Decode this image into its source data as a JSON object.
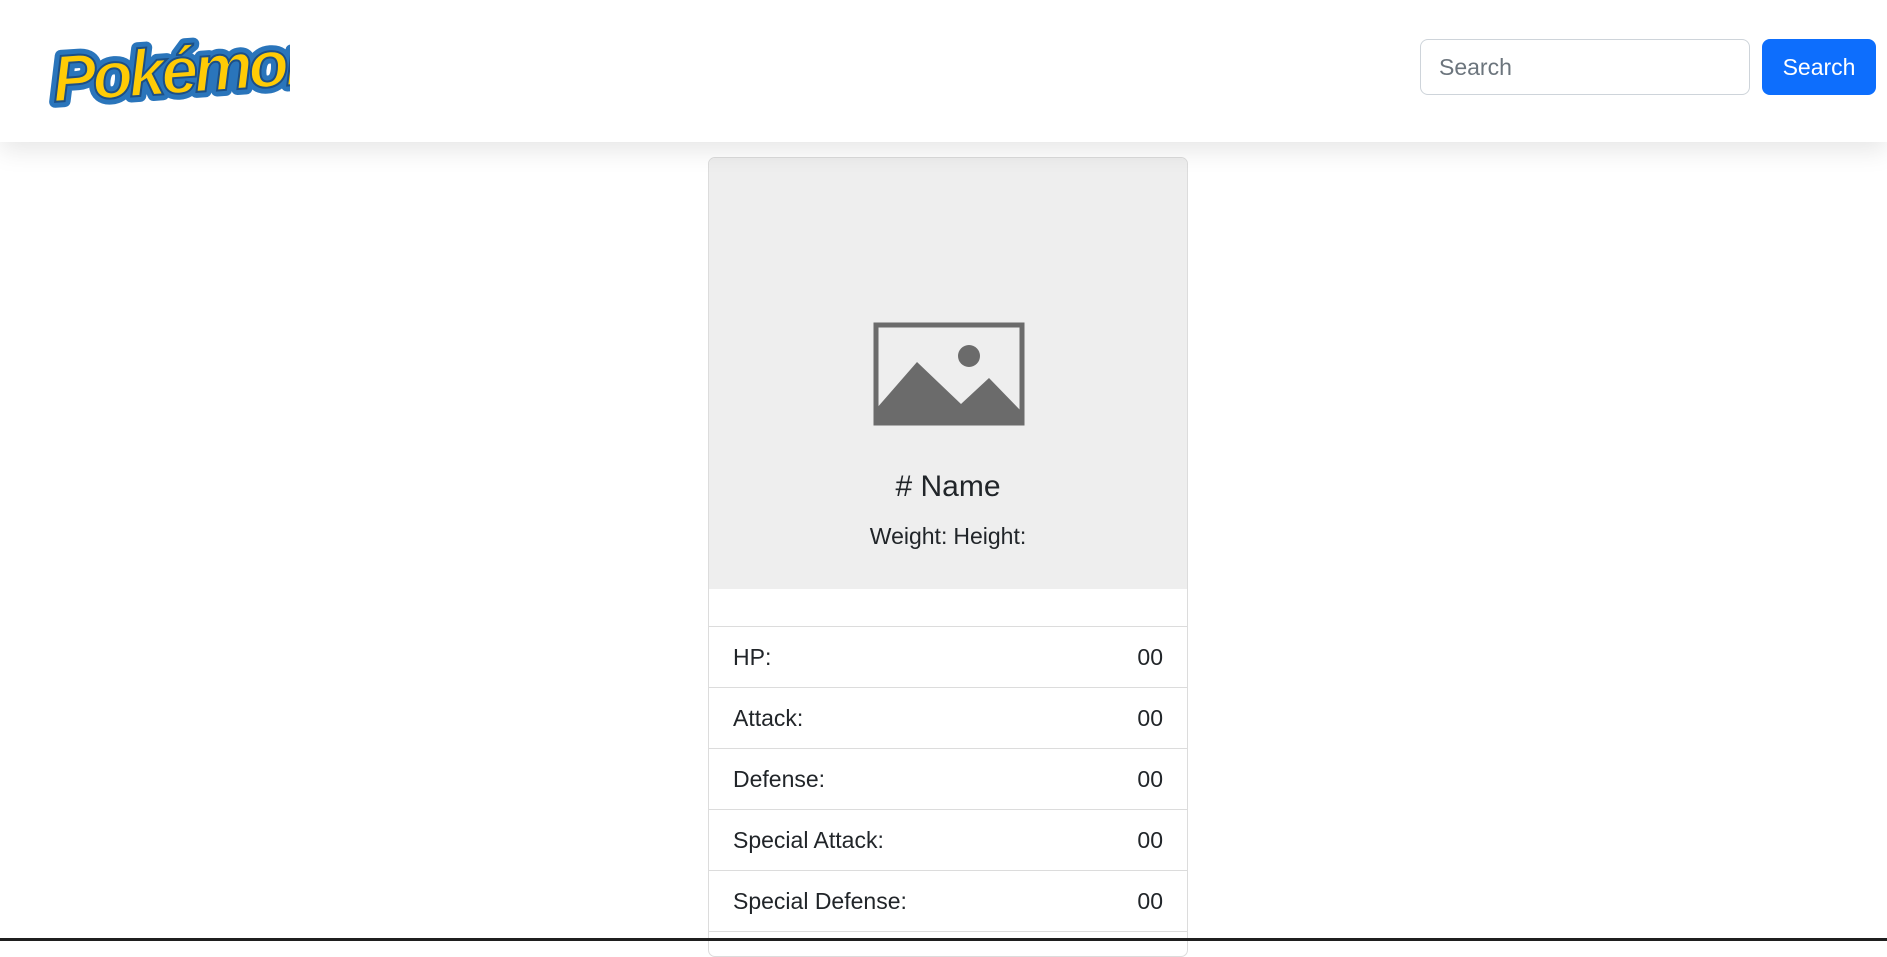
{
  "header": {
    "logo_text": "Pokémon",
    "search": {
      "placeholder": "Search",
      "value": "",
      "button_label": "Search"
    }
  },
  "card": {
    "image_icon": "image-placeholder-icon",
    "name": "# Name",
    "weight_label": "Weight:",
    "height_label": "Height:",
    "stats": [
      {
        "label": "HP:",
        "value": "00"
      },
      {
        "label": "Attack:",
        "value": "00"
      },
      {
        "label": "Defense:",
        "value": "00"
      },
      {
        "label": "Special Attack:",
        "value": "00"
      },
      {
        "label": "Special Defense:",
        "value": "00"
      }
    ]
  },
  "colors": {
    "accent": "#0d6efd",
    "logo_yellow": "#ffcb05",
    "logo_blue": "#2a75bb",
    "card_header_bg": "#eeeeee",
    "placeholder_icon": "#6b6b6b"
  }
}
